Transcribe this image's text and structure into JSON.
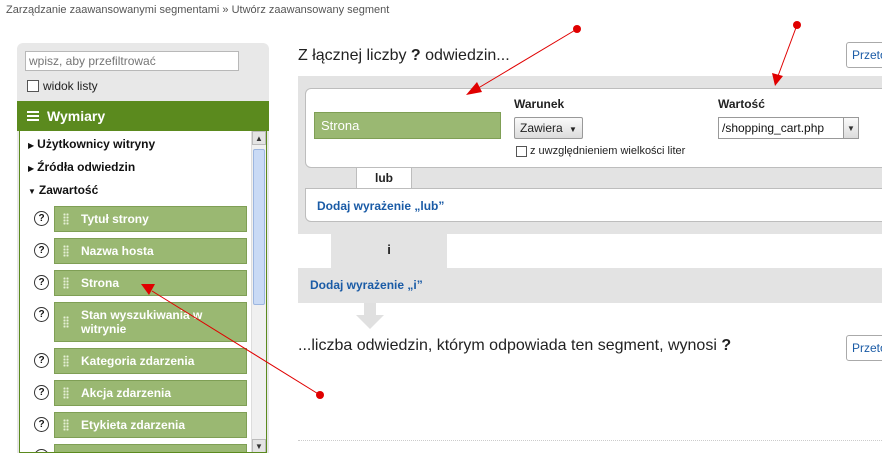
{
  "breadcrumb": "Zarządzanie zaawansowanymi segmentami » Utwórz zaawansowany segment",
  "sidebar": {
    "filter_placeholder": "wpisz, aby przefiltrować",
    "list_view_label": "widok listy",
    "dimensions_header": "Wymiary",
    "categories": [
      {
        "label": "Użytkownicy witryny",
        "state": "collapsed"
      },
      {
        "label": "Źródła odwiedzin",
        "state": "collapsed"
      },
      {
        "label": "Zawartość",
        "state": "expanded"
      }
    ],
    "items": [
      {
        "label": "Tytuł strony"
      },
      {
        "label": "Nazwa hosta"
      },
      {
        "label": "Strona"
      },
      {
        "label": "Stan wyszukiwania w witrynie"
      },
      {
        "label": "Kategoria zdarzenia"
      },
      {
        "label": "Akcja zdarzenia"
      },
      {
        "label": "Etykieta zdarzenia"
      }
    ],
    "help_glyph": "?"
  },
  "main": {
    "title_prefix": "Z łącznej liczby ",
    "title_q": "?",
    "title_suffix": " odwiedzin...",
    "right_button": "Przeto",
    "condition": {
      "dimension": "Strona",
      "condition_label": "Warunek",
      "condition_value": "Zawiera",
      "value_label": "Wartość",
      "value": "/shopping_cart.php",
      "case_label": "z uwzględnieniem wielkości liter"
    },
    "or_tab": "lub",
    "add_or": "Dodaj wyrażenie „lub”",
    "and_tab": "i",
    "add_and": "Dodaj wyrażenie „i”",
    "result_prefix": "...liczba odwiedzin, którym odpowiada ten segment, wynosi ",
    "result_q": "?",
    "result_button": "Przeto"
  },
  "colors": {
    "accent_green": "#5b8a1e",
    "pill_green": "#9ab872",
    "link_blue": "#1a5ba6",
    "annotation_red": "#e00000"
  },
  "icons": {
    "help": "question-circle-icon",
    "grip": "drag-grip-icon",
    "dropdown": "chevron-down-icon",
    "arrow": "down-arrow-icon"
  }
}
